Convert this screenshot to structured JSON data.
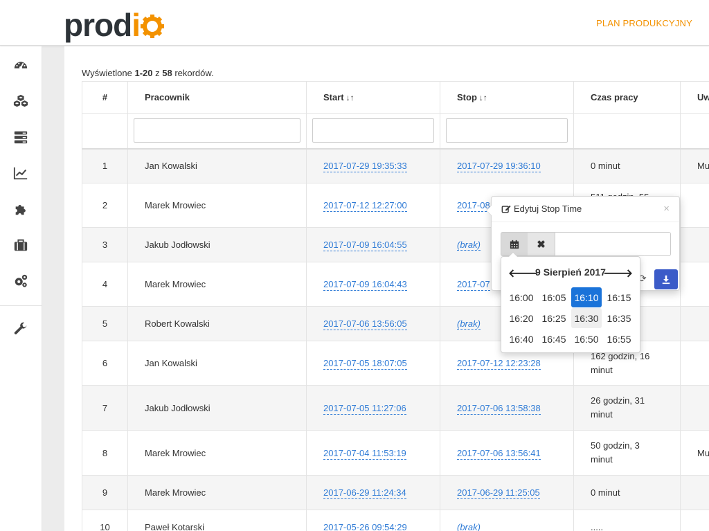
{
  "header": {
    "logo_text": "prod",
    "logo_suffix": "o",
    "nav_link": "PLAN PRODUKCYJNY",
    "brand_color": "#f39200"
  },
  "sidebar": {
    "items": [
      {
        "icon": "dashboard-icon"
      },
      {
        "icon": "cubes-icon"
      },
      {
        "icon": "server-icon"
      },
      {
        "icon": "line-chart-icon"
      },
      {
        "icon": "puzzle-icon"
      },
      {
        "icon": "briefcase-icon"
      },
      {
        "icon": "cogs-icon"
      },
      {
        "icon": "wrench-icon"
      }
    ]
  },
  "records": {
    "prefix": "Wyświetlone ",
    "range": "1-20",
    "middle": " z ",
    "total": "58",
    "suffix": " rekordów."
  },
  "table": {
    "headers": [
      "#",
      "Pracownik",
      "Start",
      "Stop",
      "Czas pracy",
      "Uw"
    ],
    "sort_icon": "↓↑",
    "rows": [
      {
        "num": "1",
        "worker": "Jan Kowalski",
        "start": "2017-07-29 19:35:33",
        "stop": "2017-07-29 19:36:10",
        "time": "0 minut",
        "note": "Mu"
      },
      {
        "num": "2",
        "worker": "Marek Mrowiec",
        "start": "2017-07-12 12:27:00",
        "stop": "2017-08",
        "time": "511 godzin, 55",
        "note": ""
      },
      {
        "num": "3",
        "worker": "Jakub Jodłowski",
        "start": "2017-07-09 16:04:55",
        "stop": "(brak)",
        "time": "",
        "note": ""
      },
      {
        "num": "4",
        "worker": "Marek Mrowiec",
        "start": "2017-07-09 16:04:43",
        "stop": "2017-07",
        "time": "",
        "note": ""
      },
      {
        "num": "5",
        "worker": "Robert Kowalski",
        "start": "2017-07-06 13:56:05",
        "stop": "(brak)",
        "time": "",
        "note": ""
      },
      {
        "num": "6",
        "worker": "Jan Kowalski",
        "start": "2017-07-05 18:07:05",
        "stop": "2017-07-12 12:23:28",
        "time": "162 godzin, 16 minut",
        "note": ""
      },
      {
        "num": "7",
        "worker": "Jakub Jodłowski",
        "start": "2017-07-05 11:27:06",
        "stop": "2017-07-06 13:58:38",
        "time": "26 godzin, 31 minut",
        "note": ""
      },
      {
        "num": "8",
        "worker": "Marek Mrowiec",
        "start": "2017-07-04 11:53:19",
        "stop": "2017-07-06 13:56:41",
        "time": "50 godzin, 3 minut",
        "note": "Mu"
      },
      {
        "num": "9",
        "worker": "Marek Mrowiec",
        "start": "2017-06-29 11:24:34",
        "stop": "2017-06-29 11:25:05",
        "time": "0 minut",
        "note": ""
      },
      {
        "num": "10",
        "worker": "Paweł Kotarski",
        "start": "2017-05-26 09:54:29",
        "stop": "(brak)",
        "time": ".....",
        "note": ""
      }
    ]
  },
  "popover": {
    "title": "Edytuj Stop Time",
    "close": "×",
    "clear": "✖",
    "input_value": ""
  },
  "picker": {
    "title": "9 Sierpień 2017",
    "prev": "🡐",
    "next": "🡒",
    "times": [
      "16:00",
      "16:05",
      "16:10",
      "16:15",
      "16:20",
      "16:25",
      "16:30",
      "16:35",
      "16:40",
      "16:45",
      "16:50",
      "16:55"
    ],
    "selected": "16:10",
    "accent": "#1a73d9"
  }
}
